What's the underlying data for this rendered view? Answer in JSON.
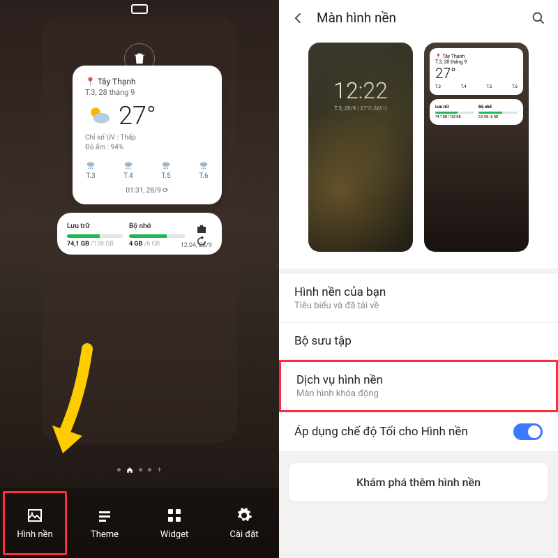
{
  "left": {
    "weather": {
      "location": "Tây Thạnh",
      "date": "T.3, 28 tháng 9",
      "temp": "27°",
      "uv": "Chỉ số UV : Thấp",
      "humidity": "Độ ẩm : 94%",
      "days": [
        "T.3",
        "T.4",
        "T.5",
        "T.6"
      ],
      "updated": "01:31, 28/9"
    },
    "storage": {
      "left_label": "Lưu trữ",
      "left_used": "74,1 GB",
      "left_total": " /128 GB",
      "right_label": "Bộ nhớ",
      "right_used": "4 GB",
      "right_total": " /6 GB",
      "updated": "12:04, 28/9"
    },
    "nav": {
      "wallpaper": "Hình nền",
      "theme": "Theme",
      "widget": "Widget",
      "settings": "Cài đặt"
    }
  },
  "right": {
    "title": "Màn hình nền",
    "lock_time": "12:22",
    "lock_date": "T.3, 28/9 | 27°C ÂM U",
    "mini": {
      "loc": "Tây Thạnh",
      "date": "T.3, 28 tháng 9",
      "temp": "27°",
      "d1": "T.3",
      "d2": "T.4",
      "d3": "T.5",
      "d4": "T.6",
      "sl": "Lưu trữ",
      "sv": "74,1 GB /128 GB",
      "ml": "Bộ nhớ",
      "mv": "3,5 GB /6 GB"
    },
    "items": {
      "yours_t": "Hình nền của bạn",
      "yours_s": "Tiêu biểu và đã tải về",
      "coll_t": "Bộ sưu tập",
      "svc_t": "Dịch vụ hình nền",
      "svc_s": "Màn hình khóa động",
      "dark_t": "Áp dụng chế độ Tối cho Hình nền"
    },
    "explore": "Khám phá thêm hình nền"
  }
}
